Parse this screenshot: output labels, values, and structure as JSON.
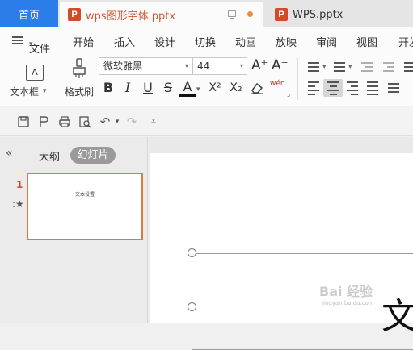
{
  "tabs": {
    "home": "首页",
    "active_file": "wps图形字体.pptx",
    "other_file": "WPS.pptx",
    "file_icon_letter": "P"
  },
  "menu": {
    "file": "文件",
    "items": [
      "开始",
      "插入",
      "设计",
      "切换",
      "动画",
      "放映",
      "审阅",
      "视图",
      "开发"
    ]
  },
  "ribbon": {
    "textbox_label": "文本框",
    "format_painter_label": "格式刷",
    "font_name": "微软雅黑",
    "font_size": "44",
    "grow_font": "A⁺",
    "shrink_font": "A⁻",
    "bold": "B",
    "italic": "I",
    "underline": "U",
    "strikethrough": "S",
    "font_color": "A",
    "superscript": "X²",
    "subscript": "X₂",
    "phonetic": "wén"
  },
  "panel": {
    "outline_tab": "大纲",
    "slides_tab": "幻灯片",
    "slide_number": "1",
    "thumbnail_text": "文本设置"
  },
  "canvas": {
    "visible_glyph": "文"
  },
  "watermark": {
    "text": "Bai 经验",
    "sub": "jingyan.baidu.com"
  },
  "colors": {
    "home_tab": "#2b7de9",
    "active_tab_text": "#d2562d",
    "slide_selected_border": "#e07a3c"
  }
}
